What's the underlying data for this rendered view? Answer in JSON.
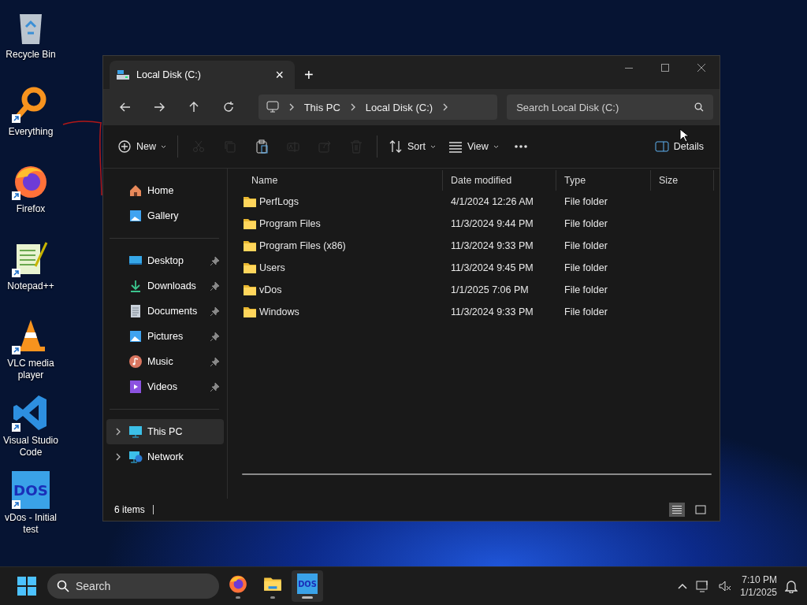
{
  "desktop_icons": [
    {
      "kind": "recycle",
      "label": "Recycle Bin",
      "shortcut": false
    },
    {
      "kind": "everything",
      "label": "Everything",
      "shortcut": true
    },
    {
      "kind": "firefox",
      "label": "Firefox",
      "shortcut": true
    },
    {
      "kind": "notepad",
      "label": "Notepad++",
      "shortcut": true
    },
    {
      "kind": "vlc",
      "label": "VLC media player",
      "shortcut": true
    },
    {
      "kind": "vscode",
      "label": "Visual Studio Code",
      "shortcut": true
    },
    {
      "kind": "vdos",
      "label": "vDos - Initial test",
      "shortcut": true,
      "icon_text": "DOS"
    }
  ],
  "window": {
    "tab": {
      "title": "Local Disk (C:)",
      "close": "×"
    },
    "new_tab": "+",
    "breadcrumb": [
      "This PC",
      "Local Disk (C:)"
    ],
    "search": {
      "placeholder": "Search Local Disk (C:)"
    },
    "toolbar": [
      {
        "kind": "new",
        "label": "New",
        "dropdown": true,
        "disabled": false
      },
      {
        "kind": "cut",
        "disabled": true
      },
      {
        "kind": "copy",
        "disabled": true
      },
      {
        "kind": "paste",
        "disabled": false
      },
      {
        "kind": "rename",
        "disabled": true
      },
      {
        "kind": "share",
        "disabled": true
      },
      {
        "kind": "delete",
        "disabled": true
      },
      {
        "kind": "sort",
        "label": "Sort",
        "dropdown": true,
        "disabled": false
      },
      {
        "kind": "view",
        "label": "View",
        "dropdown": true,
        "disabled": false
      },
      {
        "kind": "more",
        "disabled": false
      }
    ],
    "details_button": {
      "label": "Details"
    },
    "sidebar": [
      [
        {
          "kind": "home",
          "label": "Home",
          "pinned": false,
          "selected": false
        },
        {
          "kind": "gallery",
          "label": "Gallery",
          "pinned": false,
          "selected": false
        }
      ],
      [
        {
          "kind": "desktop",
          "label": "Desktop",
          "pinned": true,
          "selected": false
        },
        {
          "kind": "downloads",
          "label": "Downloads",
          "pinned": true,
          "selected": false
        },
        {
          "kind": "documents",
          "label": "Documents",
          "pinned": true,
          "selected": false
        },
        {
          "kind": "pictures",
          "label": "Pictures",
          "pinned": true,
          "selected": false
        },
        {
          "kind": "music",
          "label": "Music",
          "pinned": true,
          "selected": false
        },
        {
          "kind": "videos",
          "label": "Videos",
          "pinned": true,
          "selected": false
        }
      ],
      [
        {
          "kind": "pc",
          "label": "This PC",
          "expanded": false,
          "selected": true
        },
        {
          "kind": "network",
          "label": "Network",
          "expanded": false,
          "selected": false
        }
      ]
    ],
    "columns": [
      "Name",
      "Date modified",
      "Type",
      "Size"
    ],
    "rows": [
      {
        "name": "PerfLogs",
        "date": "4/1/2024 12:26 AM",
        "type": "File folder"
      },
      {
        "name": "Program Files",
        "date": "11/3/2024 9:44 PM",
        "type": "File folder"
      },
      {
        "name": "Program Files (x86)",
        "date": "11/3/2024 9:33 PM",
        "type": "File folder"
      },
      {
        "name": "Users",
        "date": "11/3/2024 9:45 PM",
        "type": "File folder"
      },
      {
        "name": "vDos",
        "date": "1/1/2025 7:06 PM",
        "type": "File folder"
      },
      {
        "name": "Windows",
        "date": "11/3/2024 9:33 PM",
        "type": "File folder"
      }
    ],
    "status": {
      "count": "6 items",
      "views": [
        {
          "kind": "details",
          "selected": true
        },
        {
          "kind": "tiles",
          "selected": false
        }
      ]
    }
  },
  "taskbar": {
    "search": {
      "placeholder": "Search"
    },
    "apps": [
      {
        "kind": "firefox",
        "running": true,
        "active": false
      },
      {
        "kind": "explorer",
        "running": true,
        "active": false
      },
      {
        "kind": "vdos",
        "running": true,
        "active": true,
        "icon_text": "DOS"
      }
    ],
    "time": "7:10 PM",
    "date": "1/1/2025"
  }
}
